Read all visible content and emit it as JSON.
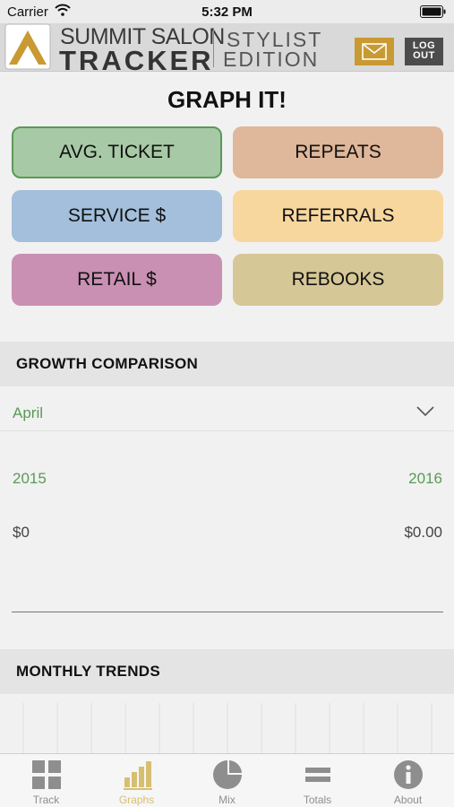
{
  "status_bar": {
    "carrier": "Carrier",
    "time": "5:32 PM"
  },
  "header": {
    "brand_line1": "SUMMIT SALON",
    "brand_line2": "TRACKER",
    "edition_line1": "STYLIST",
    "edition_line2": "EDITION",
    "logout_line1": "LOG",
    "logout_line2": "OUT",
    "accent_color": "#c99a32"
  },
  "page_title": "GRAPH IT!",
  "metrics": [
    {
      "label": "AVG. TICKET",
      "color": "#a8c9a6",
      "selected": true
    },
    {
      "label": "REPEATS",
      "color": "#dfb79a"
    },
    {
      "label": "SERVICE $",
      "color": "#a3bfdb"
    },
    {
      "label": "REFERRALS",
      "color": "#f8d79f"
    },
    {
      "label": "RETAIL $",
      "color": "#c990b3"
    },
    {
      "label": "REBOOKS",
      "color": "#d6c797"
    }
  ],
  "growth": {
    "title": "GROWTH COMPARISON",
    "month": "April",
    "year_left": "2015",
    "year_right": "2016",
    "amount_left": "$0",
    "amount_right": "$0.00"
  },
  "trends": {
    "title": "MONTHLY TRENDS"
  },
  "tabs": [
    {
      "label": "Track",
      "icon": "grid-icon"
    },
    {
      "label": "Graphs",
      "icon": "bar-chart-icon",
      "active": true
    },
    {
      "label": "Mix",
      "icon": "pie-chart-icon"
    },
    {
      "label": "Totals",
      "icon": "equals-icon"
    },
    {
      "label": "About",
      "icon": "info-icon"
    }
  ]
}
